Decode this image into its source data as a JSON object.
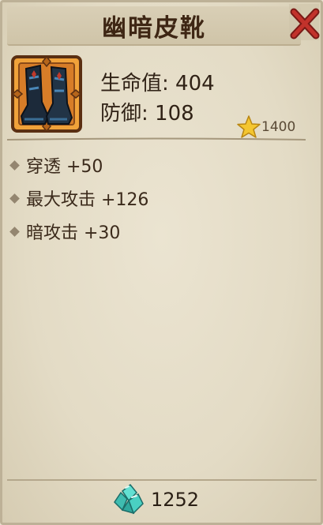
{
  "item": {
    "name": "幽暗皮靴",
    "stats": [
      {
        "label": "生命值: 404"
      },
      {
        "label": "防御: 108"
      }
    ],
    "star_value": "1400"
  },
  "attributes": [
    {
      "text": "穿透 +50"
    },
    {
      "text": "最大攻击 +126"
    },
    {
      "text": "暗攻击 +30"
    }
  ],
  "footer": {
    "gem_count": "1252"
  },
  "icons": {
    "close": "close-x-icon",
    "item": "dark-boots-icon",
    "star": "star-icon",
    "gem": "gem-crystal-icon"
  },
  "colors": {
    "panel": "#e6dfcb",
    "title_text": "#3e2614",
    "close_red": "#b02a25",
    "item_frame": "#e79832",
    "star": "#f2c22c",
    "gem": "#4fd6c7"
  }
}
